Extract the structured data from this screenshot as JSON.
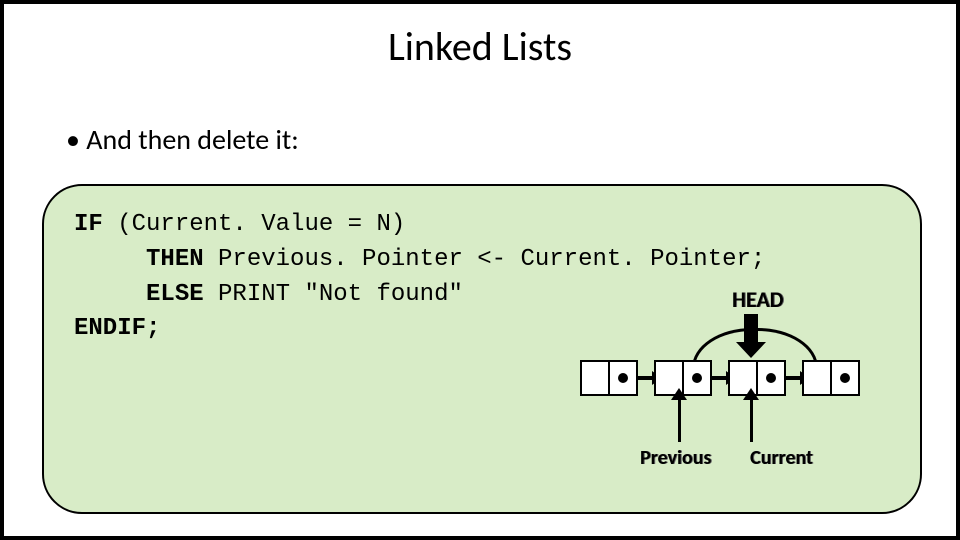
{
  "title": "Linked Lists",
  "bullet": "And then delete it:",
  "code": {
    "kw_if": "IF",
    "cond": " (Current. Value = N)",
    "kw_then": "THEN",
    "then_line": " Previous. Pointer <- Current. Pointer;",
    "kw_else": "ELSE",
    "else_line": " PRINT \"Not found\"",
    "kw_endif": "ENDIF;"
  },
  "diagram": {
    "head_label": "HEAD",
    "previous_label": "Previous",
    "current_label": "Current",
    "node_count": 4,
    "bypass_from": 2,
    "bypass_to": 4,
    "previous_points_to": 2,
    "current_points_to": 3
  }
}
